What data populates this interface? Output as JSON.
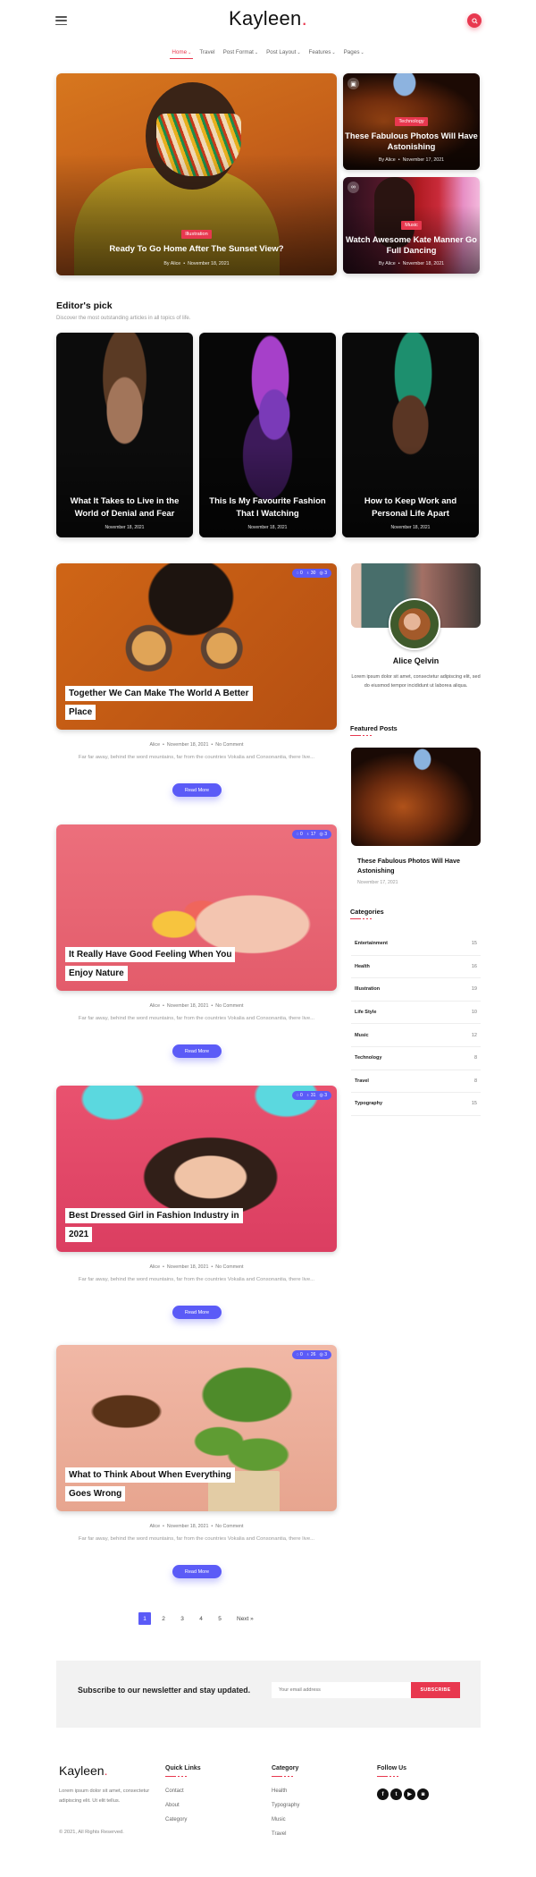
{
  "header": {
    "logo_text": "Kayleen",
    "logo_dot": ".",
    "menu_icon": "hamburger-icon",
    "search_icon": "search-icon",
    "accent_color": "#e8384f"
  },
  "nav": {
    "items": [
      {
        "label": "Home",
        "dropdown": true,
        "active": true
      },
      {
        "label": "Travel",
        "dropdown": false
      },
      {
        "label": "Post Format",
        "dropdown": true
      },
      {
        "label": "Post Layout",
        "dropdown": true
      },
      {
        "label": "Features",
        "dropdown": true
      },
      {
        "label": "Pages",
        "dropdown": true
      }
    ]
  },
  "hero": {
    "main": {
      "category": "Illustration",
      "title": "Ready To Go Home After The Sunset View?",
      "by": "By",
      "author": "Alice",
      "date": "November 18, 2021"
    },
    "side": [
      {
        "format_icon": "image-icon",
        "category": "Technology",
        "title": "These Fabulous Photos Will Have Astonishing",
        "by": "By",
        "author": "Alice",
        "date": "November 17, 2021"
      },
      {
        "format_icon": "link-icon",
        "category": "Music",
        "title": "Watch Awesome Kate Manner Go Full Dancing",
        "by": "By",
        "author": "Alice",
        "date": "November 18, 2021"
      }
    ]
  },
  "editors_pick": {
    "title": "Editor's pick",
    "subtitle": "Discover the most outstanding articles in all topics of life.",
    "cards": [
      {
        "title": "What It Takes to Live in the World of Denial and Fear",
        "date": "November 18, 2021"
      },
      {
        "title": "This Is My Favourite Fashion That I Watching",
        "date": "November 18, 2021"
      },
      {
        "title": "How to Keep Work and Personal Life Apart",
        "date": "November 18, 2021"
      }
    ]
  },
  "posts": [
    {
      "title": "Together We Can Make The World A Better Place",
      "comments": "0",
      "likes": "30",
      "views": "3",
      "author": "Alice",
      "date": "November 18, 2021",
      "comment_text": "No Comment",
      "excerpt": "Far far away, behind the word mountains, far from the countries Vokalia and Consonantia, there live...",
      "button": "Read More"
    },
    {
      "title": "It Really Have Good Feeling When You Enjoy Nature",
      "comments": "0",
      "likes": "17",
      "views": "3",
      "author": "Alice",
      "date": "November 18, 2021",
      "comment_text": "No Comment",
      "excerpt": "Far far away, behind the word mountains, far from the countries Vokalia and Consonantia, there live...",
      "button": "Read More"
    },
    {
      "title": "Best Dressed Girl in Fashion Industry in 2021",
      "comments": "0",
      "likes": "31",
      "views": "3",
      "author": "Alice",
      "date": "November 18, 2021",
      "comment_text": "No Comment",
      "excerpt": "Far far away, behind the word mountains, far from the countries Vokalia and Consonantia, there live...",
      "button": "Read More"
    },
    {
      "title": "What to Think About When Everything Goes Wrong",
      "comments": "0",
      "likes": "26",
      "views": "3",
      "author": "Alice",
      "date": "November 18, 2021",
      "comment_text": "No Comment",
      "excerpt": "Far far away, behind the word mountains, far from the countries Vokalia and Consonantia, there live...",
      "button": "Read More"
    }
  ],
  "sidebar": {
    "author": {
      "name": "Alice Qelvin",
      "bio": "Lorem ipsum dolor sit amet, consectetur adipiscing elit, sed do eiusmod tempor incididunt ut laborea aliqua."
    },
    "featured": {
      "heading": "Featured Posts",
      "title": "These Fabulous Photos Will Have Astonishing",
      "date": "November 17, 2021"
    },
    "categories": {
      "heading": "Categories",
      "items": [
        {
          "name": "Entertainment",
          "count": "15"
        },
        {
          "name": "Health",
          "count": "16"
        },
        {
          "name": "Illustration",
          "count": "19"
        },
        {
          "name": "Life Style",
          "count": "10"
        },
        {
          "name": "Music",
          "count": "12"
        },
        {
          "name": "Technology",
          "count": "8"
        },
        {
          "name": "Travel",
          "count": "8"
        },
        {
          "name": "Typography",
          "count": "15"
        }
      ]
    }
  },
  "pagination": {
    "pages": [
      "1",
      "2",
      "3",
      "4",
      "5"
    ],
    "current": "1",
    "next": "Next »"
  },
  "newsletter": {
    "text": "Subscribe to our newsletter and stay updated.",
    "placeholder": "Your email address",
    "button": "SUBSCRIBE"
  },
  "footer": {
    "logo_text": "Kayleen",
    "logo_dot": ".",
    "description": "Lorem ipsum dolor sit amet, consectetur adipiscing elit. Ut elit tellus.",
    "copyright": "© 2021, All Rights Reserved.",
    "quick_links": {
      "heading": "Quick Links",
      "items": [
        "Contact",
        "About",
        "Category"
      ]
    },
    "category": {
      "heading": "Category",
      "items": [
        "Health",
        "Typography",
        "Music",
        "Travel"
      ]
    },
    "follow": {
      "heading": "Follow Us",
      "icons": [
        "facebook-icon",
        "twitter-icon",
        "youtube-icon",
        "instagram-icon"
      ]
    }
  },
  "colors": {
    "accent": "#e8384f",
    "primary_button": "#5b5bf7",
    "newsletter_bg": "#f2f2f2"
  }
}
